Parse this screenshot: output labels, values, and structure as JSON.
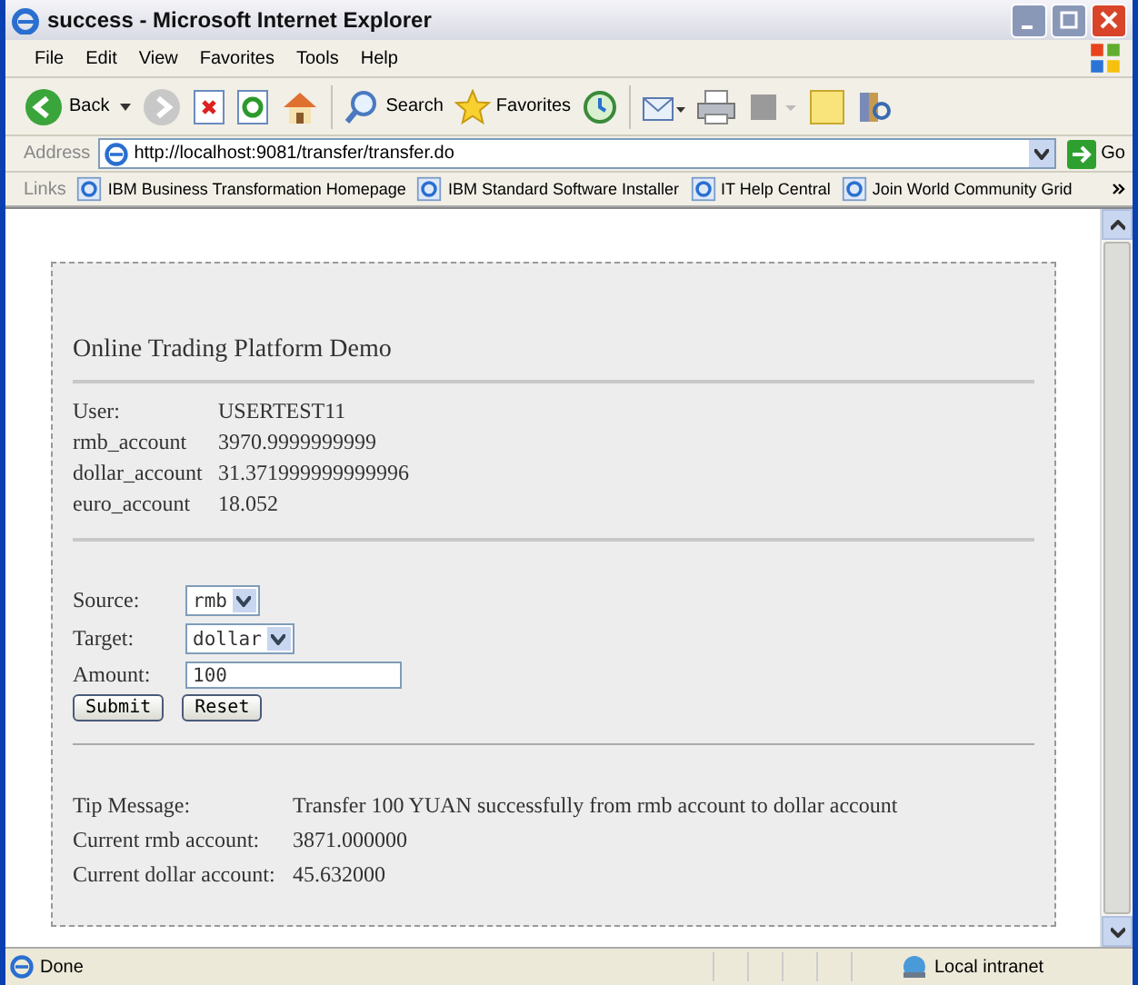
{
  "window": {
    "title": "success - Microsoft Internet Explorer"
  },
  "menu": [
    "File",
    "Edit",
    "View",
    "Favorites",
    "Tools",
    "Help"
  ],
  "toolbar": {
    "back": "Back",
    "search": "Search",
    "favorites": "Favorites"
  },
  "address": {
    "label": "Address",
    "url": "http://localhost:9081/transfer/transfer.do",
    "go": "Go"
  },
  "links": {
    "label": "Links",
    "items": [
      "IBM Business Transformation Homepage",
      "IBM Standard Software Installer",
      "IT Help Central",
      "Join World Community Grid"
    ]
  },
  "page": {
    "heading": "Online Trading Platform Demo",
    "accounts": [
      {
        "label": "User:",
        "value": "USERTEST11"
      },
      {
        "label": "rmb_account",
        "value": "3970.9999999999"
      },
      {
        "label": "dollar_account",
        "value": "31.371999999999996"
      },
      {
        "label": "euro_account",
        "value": "18.052"
      }
    ],
    "form": [
      {
        "kind": "select",
        "label": "Source:",
        "value": "rmb"
      },
      {
        "kind": "select",
        "label": "Target:",
        "value": "dollar"
      },
      {
        "kind": "text",
        "label": "Amount:",
        "value": "100"
      }
    ],
    "buttons": [
      "Submit",
      "Reset"
    ],
    "result": [
      {
        "label": "Tip Message:",
        "value": "Transfer 100 YUAN successfully from rmb account to dollar account"
      },
      {
        "label": "Current rmb account:",
        "value": "3871.000000"
      },
      {
        "label": "Current dollar account:",
        "value": "45.632000"
      }
    ]
  },
  "status_bar": {
    "text": "Done",
    "zone": "Local intranet"
  }
}
